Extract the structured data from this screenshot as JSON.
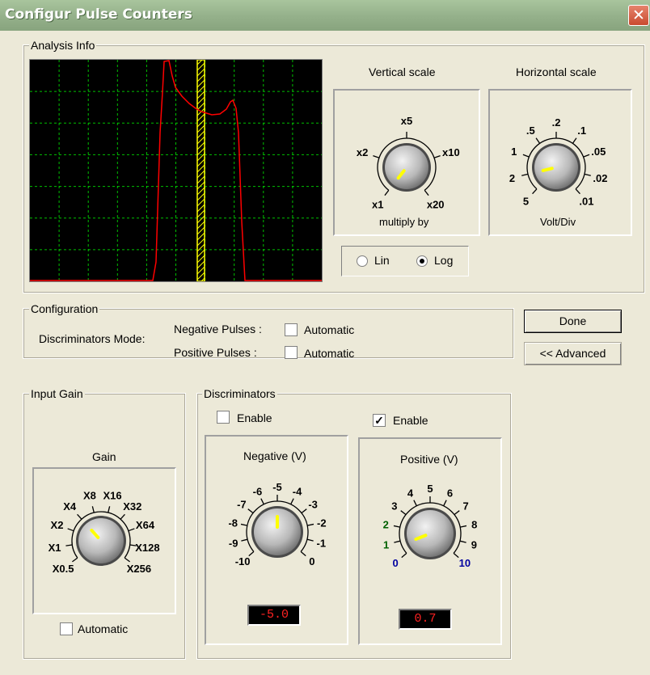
{
  "window": {
    "title": "Configur Pulse Counters",
    "close_glyph": "✕"
  },
  "analysis": {
    "legend": "Analysis Info",
    "scope": {
      "trace_color": "#ff0000",
      "grid_color": "#00ff00",
      "marker_color": "#ffff00"
    },
    "vertical": {
      "title": "Vertical scale",
      "sublabel": "multiply by",
      "ticks": [
        "x1",
        "x2",
        "x5",
        "x10",
        "x20"
      ],
      "selected": "x1"
    },
    "horizontal": {
      "title": "Horizontal scale",
      "sublabel": "Volt/Div",
      "ticks": [
        "5",
        "2",
        "1",
        ".5",
        ".2",
        ".1",
        ".05",
        ".02",
        ".01"
      ],
      "selected": "2"
    },
    "scale_mode": {
      "lin_label": "Lin",
      "log_label": "Log",
      "selected": "Log"
    }
  },
  "configuration": {
    "legend": "Configuration",
    "mode_label": "Discriminators Mode:",
    "negative_label": "Negative Pulses :",
    "positive_label": "Positive Pulses :",
    "negative_automatic": {
      "label": "Automatic",
      "checked": false
    },
    "positive_automatic": {
      "label": "Automatic",
      "checked": false
    }
  },
  "buttons": {
    "done": "Done",
    "advanced": "<< Advanced"
  },
  "input_gain": {
    "legend": "Input Gain",
    "title": "Gain",
    "ticks": [
      "X0.5",
      "X1",
      "X2",
      "X4",
      "X8",
      "X16",
      "X32",
      "X64",
      "X128",
      "X256"
    ],
    "selected": "X4",
    "automatic": {
      "label": "Automatic",
      "checked": false
    }
  },
  "discriminators": {
    "legend": "Discriminators",
    "negative": {
      "enable_label": "Enable",
      "enabled": false,
      "title": "Negative (V)",
      "ticks": [
        "-10",
        "-9",
        "-8",
        "-7",
        "-6",
        "-5",
        "-4",
        "-3",
        "-2",
        "-1",
        "0"
      ],
      "value": "-5.0"
    },
    "positive": {
      "enable_label": "Enable",
      "enabled": true,
      "title": "Positive (V)",
      "ticks": [
        "0",
        "1",
        "2",
        "3",
        "4",
        "5",
        "6",
        "7",
        "8",
        "9",
        "10"
      ],
      "value": "0.7"
    }
  }
}
